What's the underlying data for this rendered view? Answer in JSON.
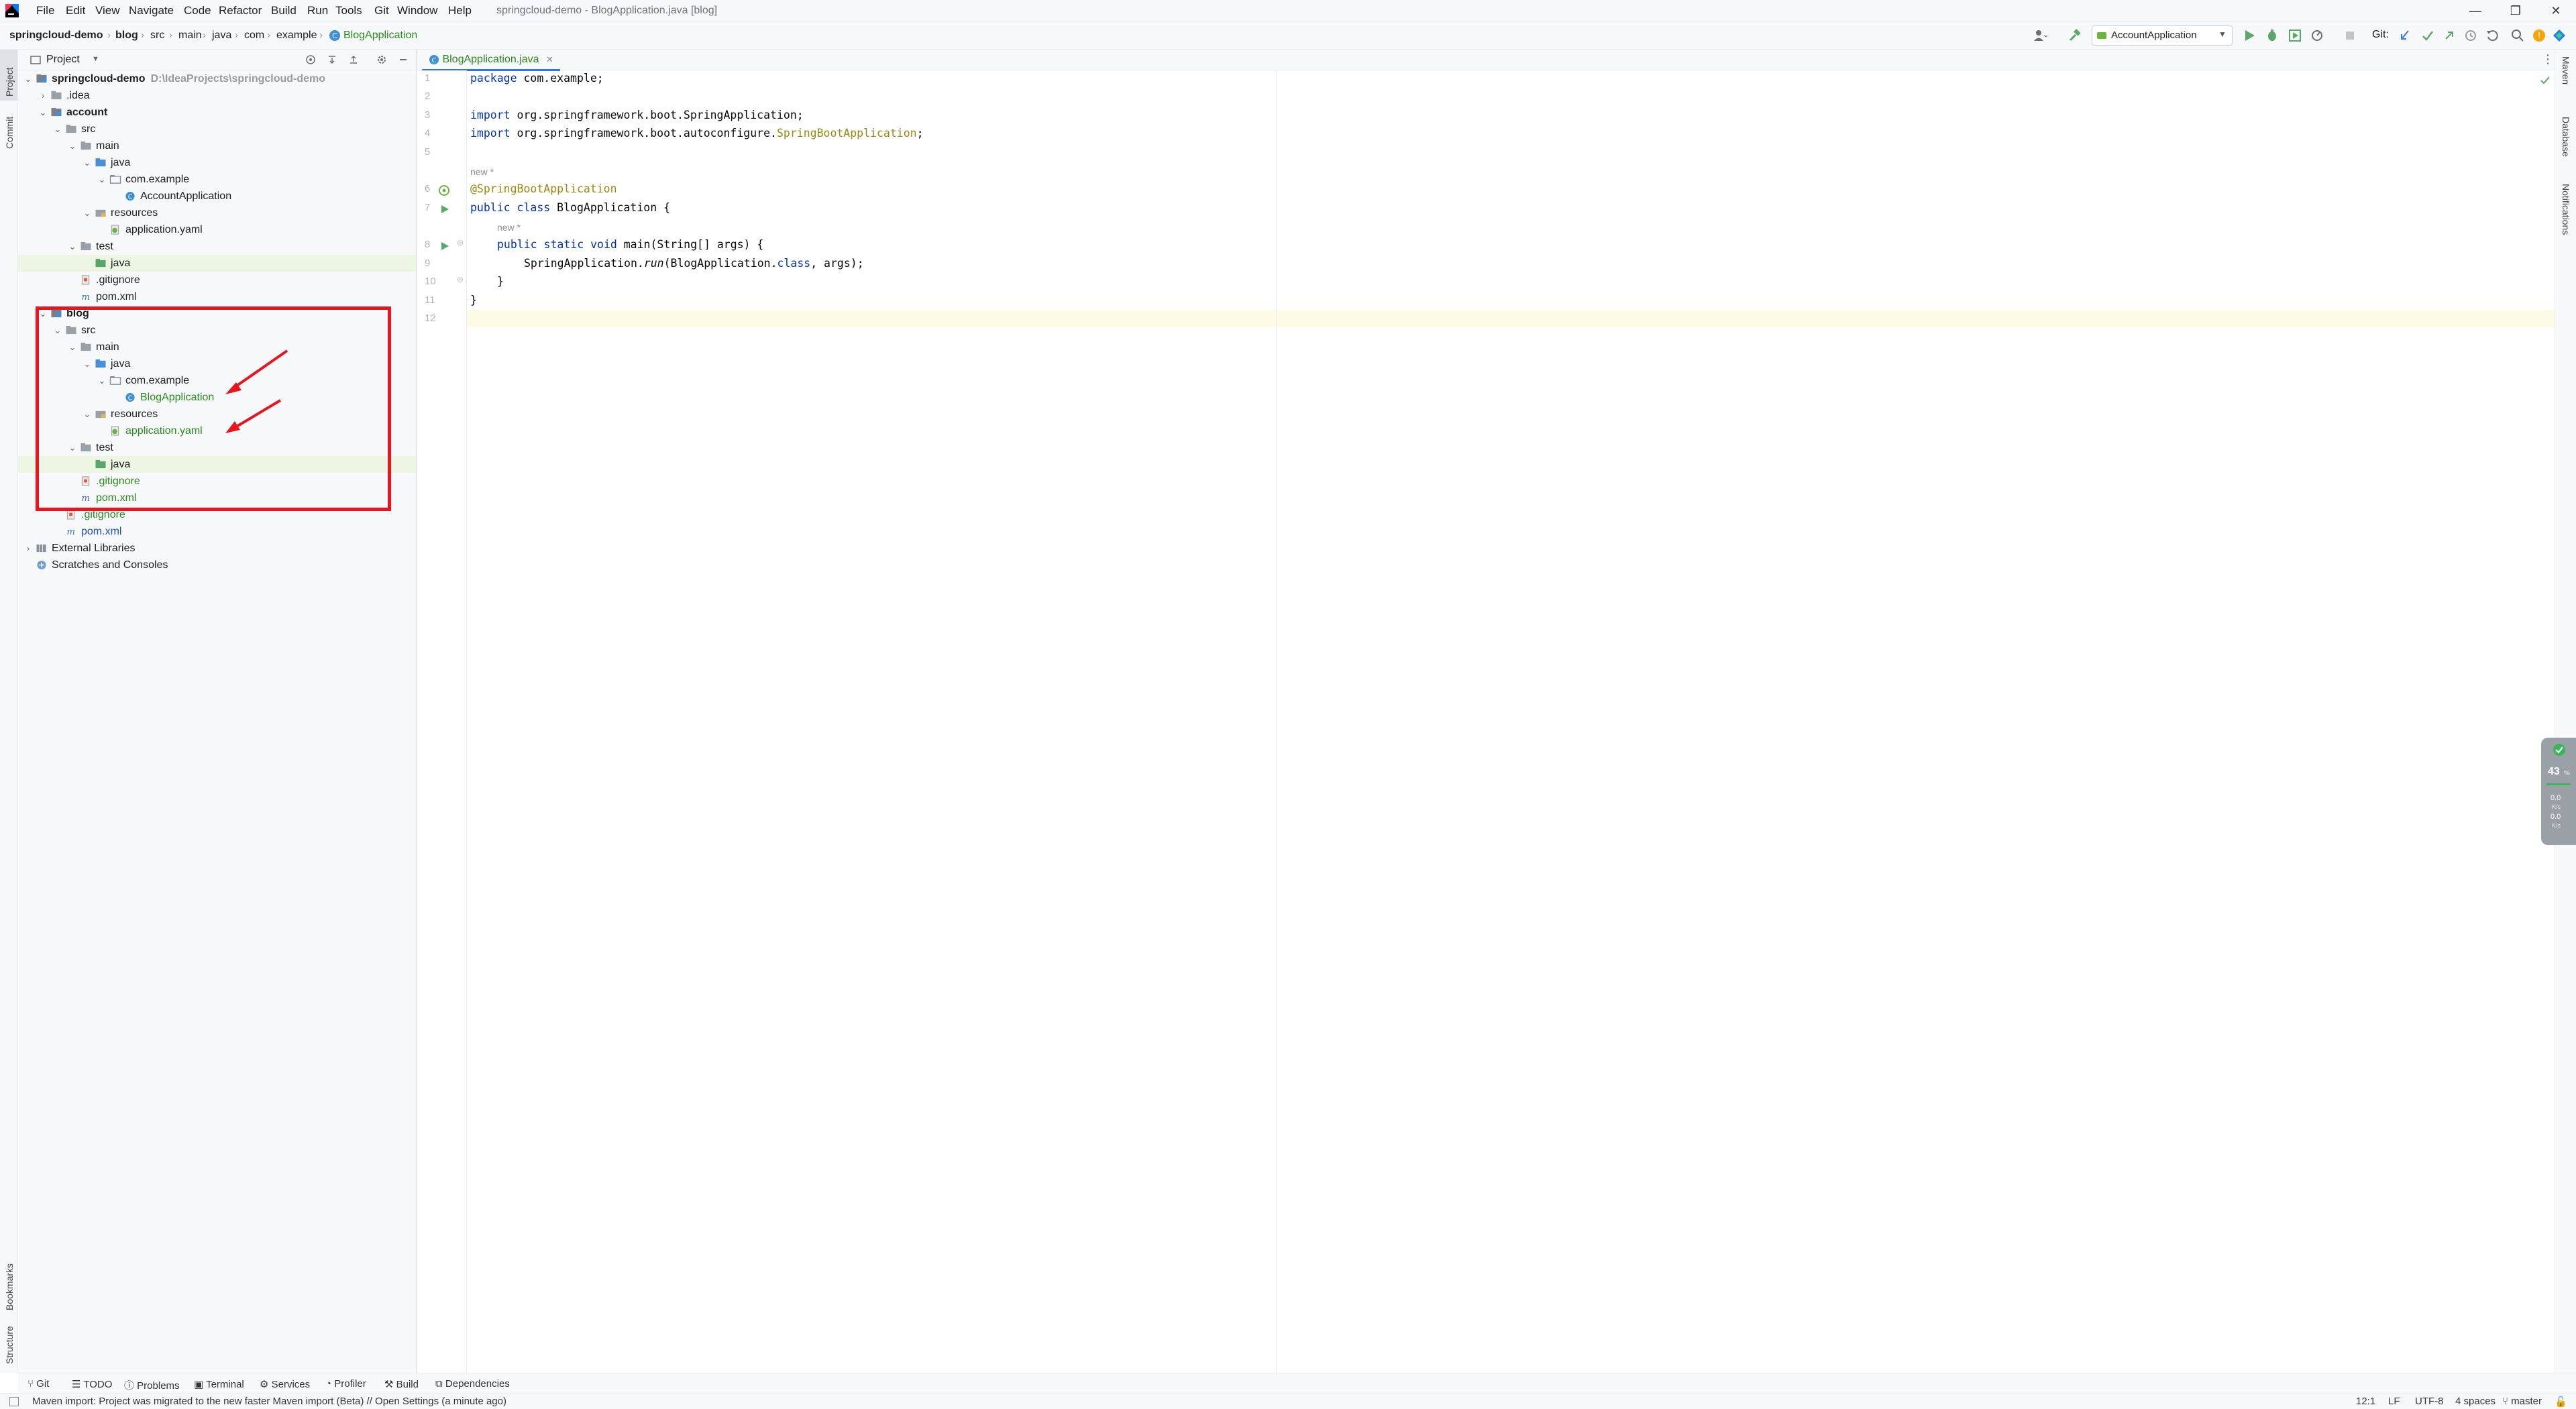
{
  "window": {
    "title": "springcloud-demo - BlogApplication.java [blog]",
    "menu": [
      "File",
      "Edit",
      "View",
      "Navigate",
      "Code",
      "Refactor",
      "Build",
      "Run",
      "Tools",
      "Git",
      "Window",
      "Help"
    ],
    "controls": {
      "minimize": "—",
      "restore": "❐",
      "close": "✕"
    }
  },
  "breadcrumb": [
    "springcloud-demo",
    "blog",
    "src",
    "main",
    "java",
    "com",
    "example",
    "BlogApplication"
  ],
  "toolbar": {
    "run_config": "AccountApplication",
    "git_label": "Git:"
  },
  "project_panel": {
    "title": "Project",
    "tree": [
      {
        "label": "springcloud-demo",
        "hint": "D:\\IdeaProjects\\springcloud-demo",
        "type": "module",
        "bold": true,
        "indent": 0,
        "chev": "v"
      },
      {
        "label": ".idea",
        "type": "folder",
        "indent": 1,
        "chev": ">"
      },
      {
        "label": "account",
        "type": "module",
        "bold": true,
        "indent": 1,
        "chev": "v"
      },
      {
        "label": "src",
        "type": "folder",
        "indent": 2,
        "chev": "v"
      },
      {
        "label": "main",
        "type": "folder",
        "indent": 3,
        "chev": "v"
      },
      {
        "label": "java",
        "type": "src",
        "indent": 4,
        "chev": "v"
      },
      {
        "label": "com.example",
        "type": "package",
        "indent": 5,
        "chev": "v"
      },
      {
        "label": "AccountApplication",
        "type": "class",
        "indent": 6
      },
      {
        "label": "resources",
        "type": "res",
        "indent": 4,
        "chev": "v"
      },
      {
        "label": "application.yaml",
        "type": "yaml",
        "indent": 5
      },
      {
        "label": "test",
        "type": "folder",
        "indent": 3,
        "chev": "v"
      },
      {
        "label": "java",
        "type": "testsrc",
        "indent": 4,
        "selected": true
      },
      {
        "label": ".gitignore",
        "type": "git",
        "indent": 3
      },
      {
        "label": "pom.xml",
        "type": "maven",
        "indent": 3
      },
      {
        "label": "blog",
        "type": "module",
        "bold": true,
        "indent": 1,
        "chev": "v"
      },
      {
        "label": "src",
        "type": "folder",
        "indent": 2,
        "chev": "v"
      },
      {
        "label": "main",
        "type": "folder",
        "indent": 3,
        "chev": "v"
      },
      {
        "label": "java",
        "type": "src",
        "indent": 4,
        "chev": "v"
      },
      {
        "label": "com.example",
        "type": "package",
        "indent": 5,
        "chev": "v"
      },
      {
        "label": "BlogApplication",
        "type": "class",
        "indent": 6,
        "color": "green"
      },
      {
        "label": "resources",
        "type": "res",
        "indent": 4,
        "chev": "v"
      },
      {
        "label": "application.yaml",
        "type": "yaml",
        "indent": 5,
        "color": "green"
      },
      {
        "label": "test",
        "type": "folder",
        "indent": 3,
        "chev": "v"
      },
      {
        "label": "java",
        "type": "testsrc",
        "indent": 4,
        "selected": true
      },
      {
        "label": ".gitignore",
        "type": "git",
        "indent": 3,
        "color": "green"
      },
      {
        "label": "pom.xml",
        "type": "maven",
        "indent": 3,
        "color": "green"
      },
      {
        "label": ".gitignore",
        "type": "git",
        "indent": 2,
        "color": "green"
      },
      {
        "label": "pom.xml",
        "type": "maven",
        "indent": 2,
        "color": "blue"
      },
      {
        "label": "External Libraries",
        "type": "lib",
        "indent": 0,
        "chev": ">"
      },
      {
        "label": "Scratches and Consoles",
        "type": "scratch",
        "indent": 0
      }
    ]
  },
  "editor": {
    "tab": "BlogApplication.java",
    "line_numbers": [
      "1",
      "2",
      "3",
      "4",
      "5",
      "6",
      "7",
      "8",
      "9",
      "10",
      "11",
      "12"
    ],
    "hint_new": "new *",
    "code": {
      "l1_kw": "package",
      "l1_rest": " com.example;",
      "l3_kw": "import",
      "l3_rest": " org.springframework.boot.SpringApplication;",
      "l4_kw": "import",
      "l4_rest": " org.springframework.boot.autoconfigure.",
      "l4_ann": "SpringBootApplication",
      "l4_end": ";",
      "l6_ann": "@SpringBootApplication",
      "l7_kw": "public class",
      "l7_rest": " BlogApplication {",
      "l8_kw": "public static void",
      "l8_rest": " main(String[] args) {",
      "l9_a": "SpringApplication.",
      "l9_b": "run",
      "l9_c": "(BlogApplication.",
      "l9_kw": "class",
      "l9_d": ", args);",
      "l10": "}",
      "l11": "}"
    }
  },
  "left_strip": [
    "Project",
    "Commit",
    "Bookmarks",
    "Structure"
  ],
  "right_strip": [
    "Maven",
    "Database",
    "Notifications"
  ],
  "bottom_tabs": [
    "Git",
    "TODO",
    "Problems",
    "Terminal",
    "Services",
    "Profiler",
    "Build",
    "Dependencies"
  ],
  "status": {
    "message": "Maven import: Project was migrated to the new faster Maven import (Beta) // Open Settings (a minute ago)",
    "position": "12:1",
    "line_sep": "LF",
    "encoding": "UTF-8",
    "indent": "4 spaces",
    "branch": "master"
  },
  "widget": {
    "value": "43",
    "unit": "%",
    "up": "0.0",
    "down": "0.0",
    "rate_unit": "K/s"
  },
  "colors": {
    "highlight": "#e8141e",
    "accent": "#3574f0",
    "green": "#2b8a1d"
  }
}
